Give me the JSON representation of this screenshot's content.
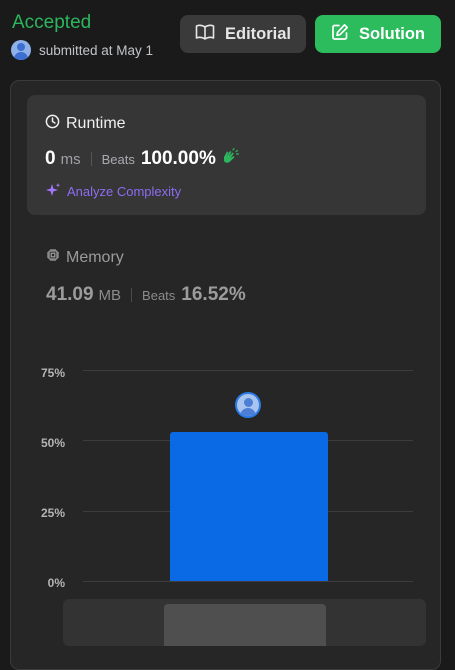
{
  "header": {
    "status": "Accepted",
    "submitted_text": "submitted at May 1",
    "editorial_label": "Editorial",
    "solution_label": "Solution"
  },
  "runtime": {
    "title": "Runtime",
    "value": "0",
    "unit": "ms",
    "beats_label": "Beats",
    "beats_value": "100.00%",
    "analyze_label": "Analyze Complexity"
  },
  "memory": {
    "title": "Memory",
    "value": "41.09",
    "unit": "MB",
    "beats_label": "Beats",
    "beats_value": "16.52%"
  },
  "colors": {
    "accepted": "#2db55d",
    "solution_button": "#2cbb5d",
    "bar": "#0a6ae6",
    "analyze": "#8e6cf0"
  },
  "icons": [
    "user-avatar-icon",
    "book-icon",
    "edit-icon",
    "clock-icon",
    "clapping-hands-icon",
    "sparkle-icon",
    "chip-icon"
  ],
  "chart_data": {
    "type": "bar",
    "categories": [
      ""
    ],
    "values": [
      53
    ],
    "ylim": [
      0,
      75
    ],
    "yticks": [
      "75%",
      "50%",
      "25%",
      "0%"
    ],
    "grid": true
  }
}
